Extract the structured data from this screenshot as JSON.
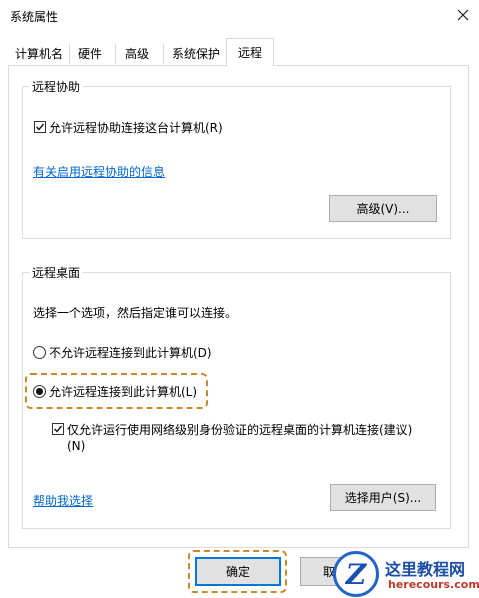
{
  "window": {
    "title": "系统属性",
    "close_icon": "close-icon"
  },
  "tabs": [
    {
      "label": "计算机名",
      "active": false
    },
    {
      "label": "硬件",
      "active": false
    },
    {
      "label": "高级",
      "active": false
    },
    {
      "label": "系统保护",
      "active": false
    },
    {
      "label": "远程",
      "active": true
    }
  ],
  "remote_assistance": {
    "legend": "远程协助",
    "allow_checkbox_label": "允许远程协助连接这台计算机(R)",
    "allow_checked": true,
    "info_link": "有关启用远程协助的信息",
    "advanced_button": "高级(V)..."
  },
  "remote_desktop": {
    "legend": "远程桌面",
    "instruction": "选择一个选项，然后指定谁可以连接。",
    "option_disallow": "不允许远程连接到此计算机(D)",
    "option_allow": "允许远程连接到此计算机(L)",
    "selected_option": "allow",
    "nla_checkbox_line1": "仅允许运行使用网络级别身份验证的远程桌面的计算机连接(建议)",
    "nla_checkbox_line2": "(N)",
    "nla_checked": true,
    "help_link": "帮助我选择",
    "select_users_button": "选择用户(S)..."
  },
  "footer": {
    "ok_button": "确定",
    "cancel_button_partial": "取"
  },
  "watermark": {
    "name": "这里教程网",
    "url": "herecours.com",
    "badge_letter": "Z"
  },
  "colors": {
    "link": "#0066cc",
    "highlight": "#c98a2b",
    "primary_border": "#0078d7"
  }
}
